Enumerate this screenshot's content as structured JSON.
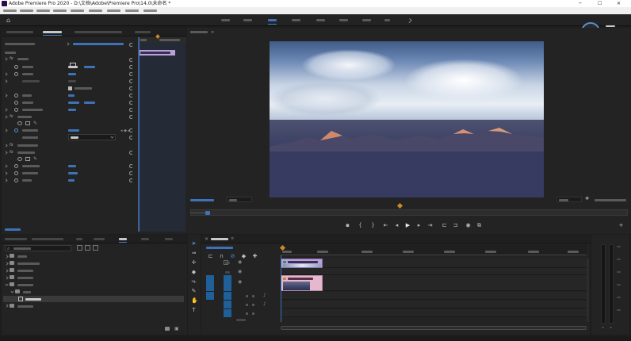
{
  "window": {
    "title": "Adobe Premiere Pro 2020 - D:\\文档\\Adobe\\Premiere Pro\\14.0\\未命名 *"
  },
  "perf": {
    "percent": "74",
    "percent_suffix": "x"
  },
  "colors": {
    "accent": "#3d7fd6",
    "playhead": "#3d72b8",
    "in_point": "#c98a2a",
    "clip_violet": "#b7a1d6",
    "clip_pink": "#e6b8d0",
    "track_target": "#1f5f9a",
    "panel_bg": "#232323"
  },
  "icons": {
    "home": "home-icon",
    "close": "close-icon",
    "minimize": "minimize-icon",
    "maximize": "maximize-icon",
    "wrench": "wrench-icon",
    "add": "plus-icon",
    "selection_tool": "selection-tool-icon",
    "razor_tool": "razor-tool-icon",
    "hand_tool": "hand-tool-icon",
    "type_tool": "type-tool-icon",
    "pen_tool": "pen-tool-icon",
    "eye": "eye-icon",
    "lock": "lock-icon",
    "mic": "microphone-icon",
    "play": "play-icon",
    "step_back": "step-back-icon",
    "step_forward": "step-forward-icon",
    "camera": "camera-icon",
    "search": "search-icon",
    "folder": "folder-icon",
    "fx": "fx-icon",
    "stopwatch": "stopwatch-icon"
  }
}
